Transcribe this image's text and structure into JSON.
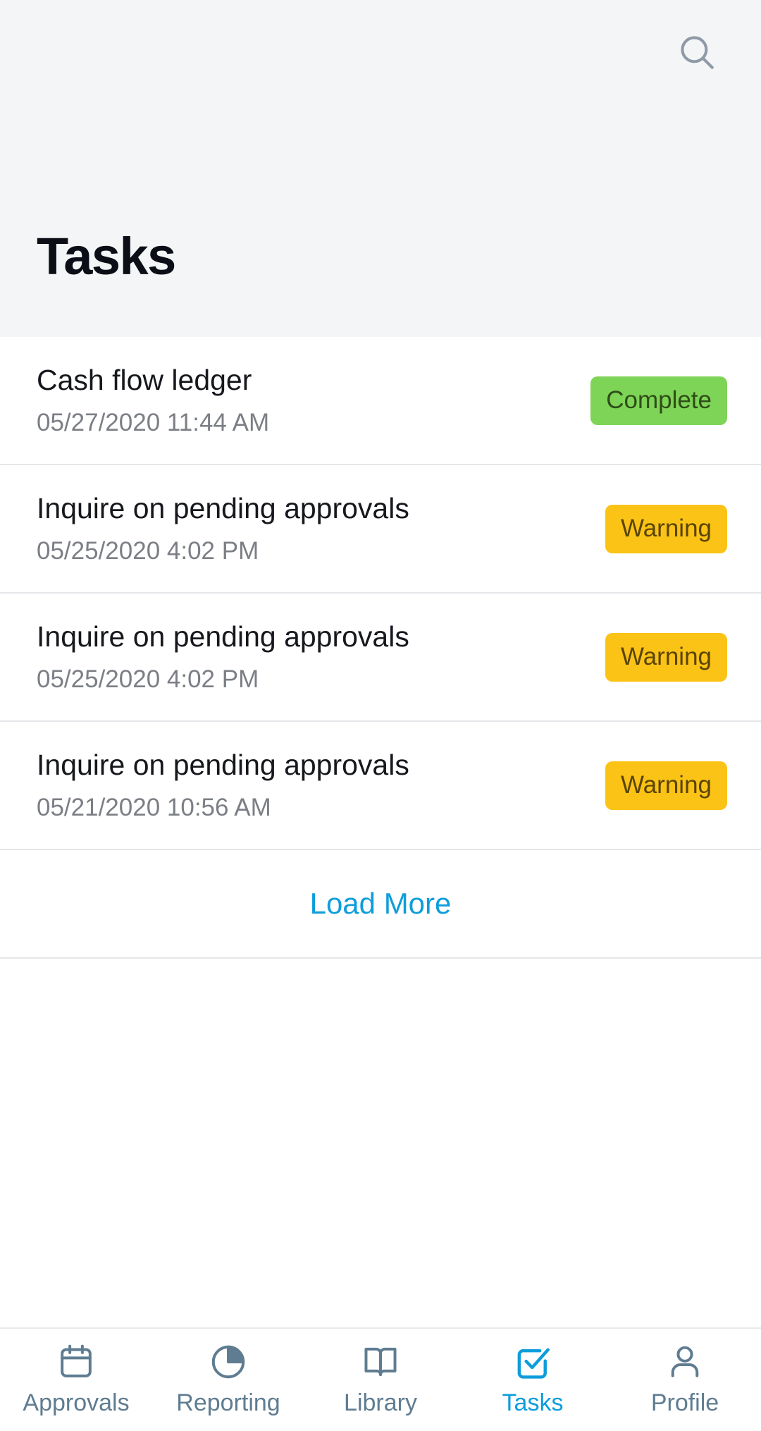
{
  "header": {
    "title": "Tasks",
    "search_icon": "search-icon",
    "background_color": "#f4f5f6"
  },
  "colors": {
    "accent": "#0d9ddb",
    "complete_badge_bg": "#7ed456",
    "complete_badge_text": "#2f4d18",
    "warning_badge_bg": "#fbc316",
    "warning_badge_text": "#5b4406",
    "inactive_tab": "#5f7c91",
    "divider": "#e4e6e9",
    "title_text": "#0b0d17",
    "date_text": "#7b7f85"
  },
  "tasks": [
    {
      "title": "Cash flow ledger",
      "date": "05/27/2020 11:44 AM",
      "status": "Complete",
      "status_type": "complete"
    },
    {
      "title": "Inquire on pending approvals",
      "date": "05/25/2020 4:02 PM",
      "status": "Warning",
      "status_type": "warning"
    },
    {
      "title": "Inquire on pending approvals",
      "date": "05/25/2020 4:02 PM",
      "status": "Warning",
      "status_type": "warning"
    },
    {
      "title": "Inquire on pending approvals",
      "date": "05/21/2020 10:56 AM",
      "status": "Warning",
      "status_type": "warning"
    }
  ],
  "load_more": {
    "label": "Load More"
  },
  "tabbar": {
    "active_index": 3,
    "items": [
      {
        "label": "Approvals",
        "icon": "calendar-icon"
      },
      {
        "label": "Reporting",
        "icon": "pie-chart-icon"
      },
      {
        "label": "Library",
        "icon": "open-book-icon"
      },
      {
        "label": "Tasks",
        "icon": "checkbox-check-icon"
      },
      {
        "label": "Profile",
        "icon": "person-icon"
      }
    ]
  }
}
